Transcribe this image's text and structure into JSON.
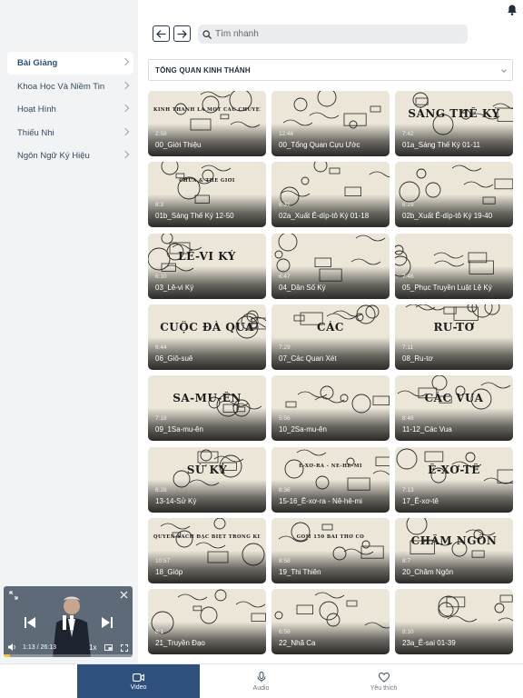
{
  "header": {
    "search_placeholder": "Tìm nhanh"
  },
  "sidebar": {
    "items": [
      {
        "label": "Bài Giảng",
        "active": true
      },
      {
        "label": "Khoa Học Và Niềm Tin",
        "active": false
      },
      {
        "label": "Hoạt Hình",
        "active": false
      },
      {
        "label": "Thiếu Nhi",
        "active": false
      },
      {
        "label": "Ngôn Ngữ Ký Hiệu",
        "active": false
      }
    ]
  },
  "category": {
    "selected": "TỔNG QUAN KINH THÁNH"
  },
  "videos": [
    {
      "title": "00_Giới Thiệu",
      "duration": "2:58",
      "art": "KINH THÁNH LÀ MỘT CÂU CHUYỆN THỐNG NHẤT"
    },
    {
      "title": "00_Tổng Quan Cựu Ước",
      "duration": "12:46",
      "art": ""
    },
    {
      "title": "01a_Sáng Thế Ký 01-11",
      "duration": "7:42",
      "art": "SÁNG THẾ KÝ"
    },
    {
      "title": "01b_Sáng Thế Ký 12-50",
      "duration": "8:3",
      "art": "CHÚA & THẾ GIỚI"
    },
    {
      "title": "02a_Xuất Ê-díp-tô Ký 01-18",
      "duration": "6:31",
      "art": ""
    },
    {
      "title": "02b_Xuất Ê-díp-tô Ký 19-40",
      "duration": "6:29",
      "art": ""
    },
    {
      "title": "03_Lê-vi Ký",
      "duration": "6:10",
      "art": "LÊ-VI KÝ"
    },
    {
      "title": "04_Dân Số Ký",
      "duration": "6:47",
      "art": ""
    },
    {
      "title": "05_Phục Truyền Luật Lệ Ký",
      "duration": "7:46",
      "art": ""
    },
    {
      "title": "06_Giô-suê",
      "duration": "6:44",
      "art": "CUỘC ĐÀ QUA"
    },
    {
      "title": "07_Các Quan Xét",
      "duration": "7:29",
      "art": "CÁC"
    },
    {
      "title": "08_Ru-tơ",
      "duration": "7:11",
      "art": "RU-TƠ"
    },
    {
      "title": "09_1Sa-mu-ên",
      "duration": "7:18",
      "art": "SA-MU-ÊN"
    },
    {
      "title": "10_2Sa-mu-ên",
      "duration": "5:56",
      "art": ""
    },
    {
      "title": "11-12_Các Vua",
      "duration": "8:48",
      "art": "CÁC VUA"
    },
    {
      "title": "13-14-Sử Ký",
      "duration": "6:28",
      "art": "SỬ KÝ"
    },
    {
      "title": "15-16_Ê-xơ-ra - Nê-hê-mi",
      "duration": "8:36",
      "art": "Ê-XƠ-RA - NÊ-HÊ-MI"
    },
    {
      "title": "17_Ê-xơ-tê",
      "duration": "7:13",
      "art": "Ê-XƠ-TÊ"
    },
    {
      "title": "18_Gióp",
      "duration": "10:57",
      "art": "QUYỂN SÁCH ĐẶC BIỆT TRONG KINH THÁNH"
    },
    {
      "title": "19_Thi Thiên",
      "duration": "8:58",
      "art": "GỒM 150 BÀI THƠ CỔ"
    },
    {
      "title": "20_Châm Ngôn",
      "duration": "8:7",
      "art": "CHÂM NGÔN"
    },
    {
      "title": "21_Truyền Đạo",
      "duration": "8:1",
      "art": ""
    },
    {
      "title": "22_Nhã Ca",
      "duration": "6:58",
      "art": ""
    },
    {
      "title": "23a_Ê-sai 01-39",
      "duration": "8:10",
      "art": ""
    }
  ],
  "player": {
    "current_time": "1:13",
    "separator": "/",
    "total_time": "26:13",
    "speed": "1x",
    "progress": 0.05
  },
  "tabbar": {
    "tabs": [
      {
        "label": "Video",
        "active": true
      },
      {
        "label": "Audio",
        "active": false
      },
      {
        "label": "Yêu thích",
        "active": false
      }
    ]
  },
  "colors": {
    "accent": "#2f4f7c",
    "progress": "#f7c52b",
    "sidebar_bg": "#f2f3f5"
  }
}
